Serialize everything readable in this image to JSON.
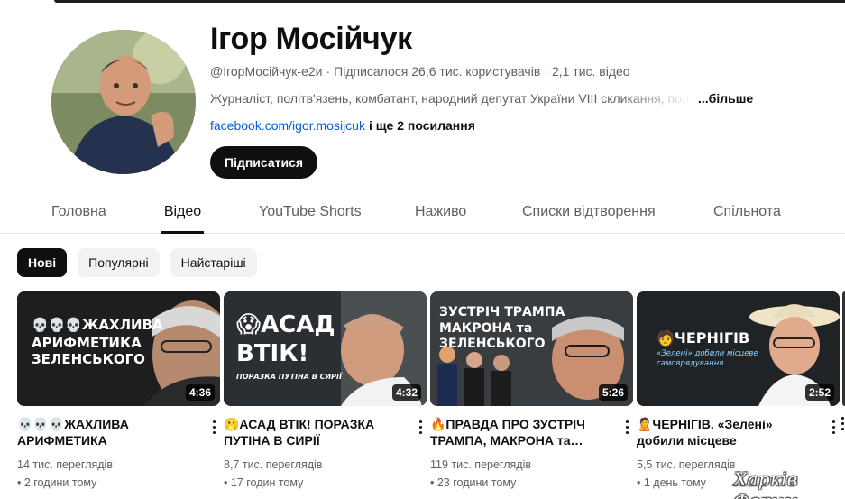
{
  "channel": {
    "name": "Ігор Мосійчук",
    "handle": "@ІгорМосійчук-е2и",
    "subscribers": "Підписалося 26,6 тис. користувачів",
    "video_count": "2,1 тис. відео",
    "description": "Журналіст, політв'язень, комбатант, народний депутат України VIII скликання, пол",
    "more_label": "...більше",
    "link_text": "facebook.com/igor.mosijcuk",
    "more_links": "і ще 2 посилання",
    "subscribe_label": "Підписатися"
  },
  "tabs": [
    {
      "label": "Головна"
    },
    {
      "label": "Відео",
      "active": true
    },
    {
      "label": "YouTube Shorts"
    },
    {
      "label": "Наживо"
    },
    {
      "label": "Списки відтворення"
    },
    {
      "label": "Спільнота"
    }
  ],
  "chips": [
    {
      "label": "Нові",
      "active": true
    },
    {
      "label": "Популярні"
    },
    {
      "label": "Найстаріші"
    }
  ],
  "videos": [
    {
      "title": "💀💀💀ЖАХЛИВА АРИФМЕТИКА ЗЕЛЕНСЬКОГО",
      "views": "14 тис. переглядів",
      "age": "• 2 години тому",
      "duration": "4:36",
      "thumb_lines": [
        "💀💀💀ЖАХЛИВА",
        "АРИФМЕТИКА",
        "ЗЕЛЕНСЬКОГО"
      ]
    },
    {
      "title": "🫢АСАД ВТІК! ПОРАЗКА ПУТІНА В СИРІЇ",
      "views": "8,7 тис. переглядів",
      "age": "• 17 годин тому",
      "duration": "4:32",
      "thumb_lines": [
        "😱АСАД",
        "ВТІК!"
      ],
      "thumb_sub": "ПОРАЗКА ПУТІНА В СИРІЇ"
    },
    {
      "title": "🔥ПРАВДА ПРО ЗУСТРІЧ ТРАМПА, МАКРОНА та…",
      "views": "119 тис. переглядів",
      "age": "• 23 години тому",
      "duration": "5:26",
      "thumb_lines": [
        "ЗУСТРІЧ ТРАМПА",
        "МАКРОНА та",
        "ЗЕЛЕНСЬКОГО"
      ]
    },
    {
      "title": "🙎ЧЕРНІГІВ. «Зелені» добили місцеве самоврядування",
      "views": "5,5 тис. переглядів",
      "age": "• 1 день тому",
      "duration": "2:52",
      "thumb_lines": [
        "🧑ЧЕРНІГІВ"
      ],
      "thumb_sub": "«Зелені» добили місцеве самоврядування"
    }
  ],
  "watermark": "Харків Форум",
  "colors": {
    "accent_link": "#065fd4",
    "text_primary": "#0f0f0f",
    "text_secondary": "#606060",
    "chip_bg": "#f2f2f2"
  }
}
